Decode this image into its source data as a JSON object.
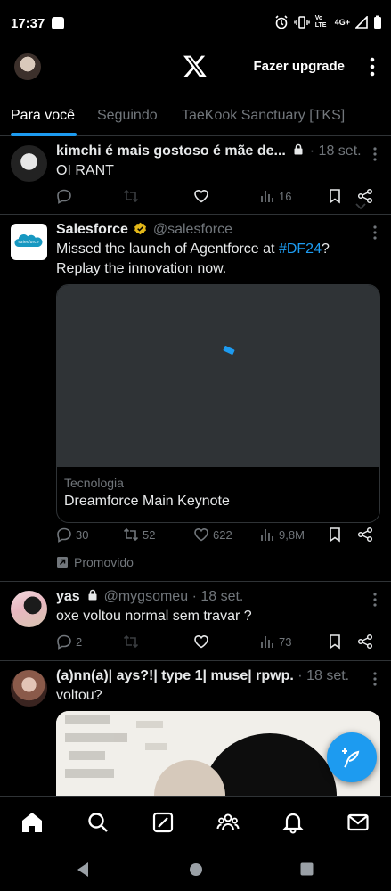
{
  "status": {
    "time": "17:37",
    "network": "4G+",
    "volte": "Vo LTE"
  },
  "header": {
    "upgrade_label": "Fazer upgrade"
  },
  "tabs": [
    {
      "label": "Para você",
      "active": true
    },
    {
      "label": "Seguindo",
      "active": false
    },
    {
      "label": "TaeKook Sanctuary [TKS]",
      "active": false
    }
  ],
  "posts": [
    {
      "name": "kimchi é mais gostoso é mãe de...",
      "locked": true,
      "date": "· 18 set.",
      "text": "OI RANT",
      "metrics": {
        "replies": "",
        "reposts": "",
        "likes": "",
        "views": "16"
      }
    },
    {
      "name": "Salesforce",
      "verified": true,
      "handle": "@salesforce",
      "text_before": "Missed the launch of Agentforce at ",
      "hashtag": "#DF24",
      "text_after": "?",
      "text_line2": "Replay the innovation now.",
      "card_category": "Tecnologia",
      "card_title": "Dreamforce Main Keynote",
      "metrics": {
        "replies": "30",
        "reposts": "52",
        "likes": "622",
        "views": "9,8M"
      },
      "promoted_label": "Promovido",
      "avatar_text": "salesforce"
    },
    {
      "name": "yas",
      "locked": true,
      "handle": "@mygsomeu",
      "date": "· 18 set.",
      "text": "oxe voltou normal sem travar ?",
      "metrics": {
        "replies": "2",
        "reposts": "",
        "likes": "",
        "views": "73"
      }
    },
    {
      "name": "(a)nn(a)| ays?!| type 1| muse| rpwp.",
      "date": "· 18 set.",
      "text": "voltou?"
    }
  ],
  "colors": {
    "accent": "#1d9bf0",
    "background": "#000000",
    "muted": "#71767b",
    "border": "#2f3336",
    "verified": "#e2b719"
  }
}
